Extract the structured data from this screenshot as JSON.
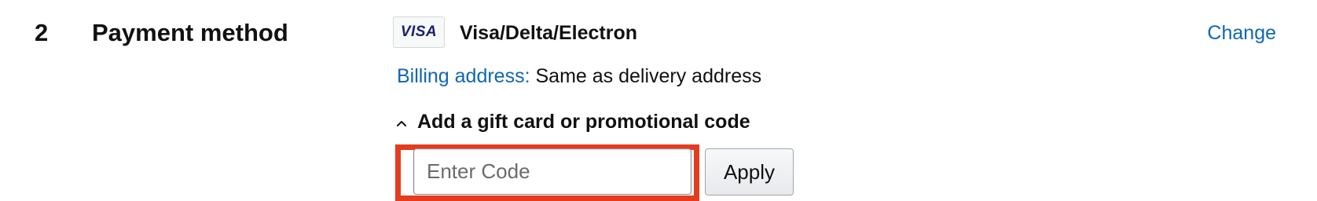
{
  "section": {
    "number": "2",
    "title": "Payment method"
  },
  "payment": {
    "card_logo_text": "VISA",
    "card_name": "Visa/Delta/Electron",
    "change_label": "Change"
  },
  "billing": {
    "label": "Billing address:",
    "value": "Same as delivery address"
  },
  "promo": {
    "toggle_label": "Add a gift card or promotional code",
    "toggle_icon": "chevron-up-icon",
    "input_placeholder": "Enter Code",
    "input_value": "",
    "apply_label": "Apply",
    "highlighted": true
  },
  "colors": {
    "link": "#0f67b1",
    "highlight": "#e53b1f",
    "visa_blue": "#1a1f71"
  }
}
